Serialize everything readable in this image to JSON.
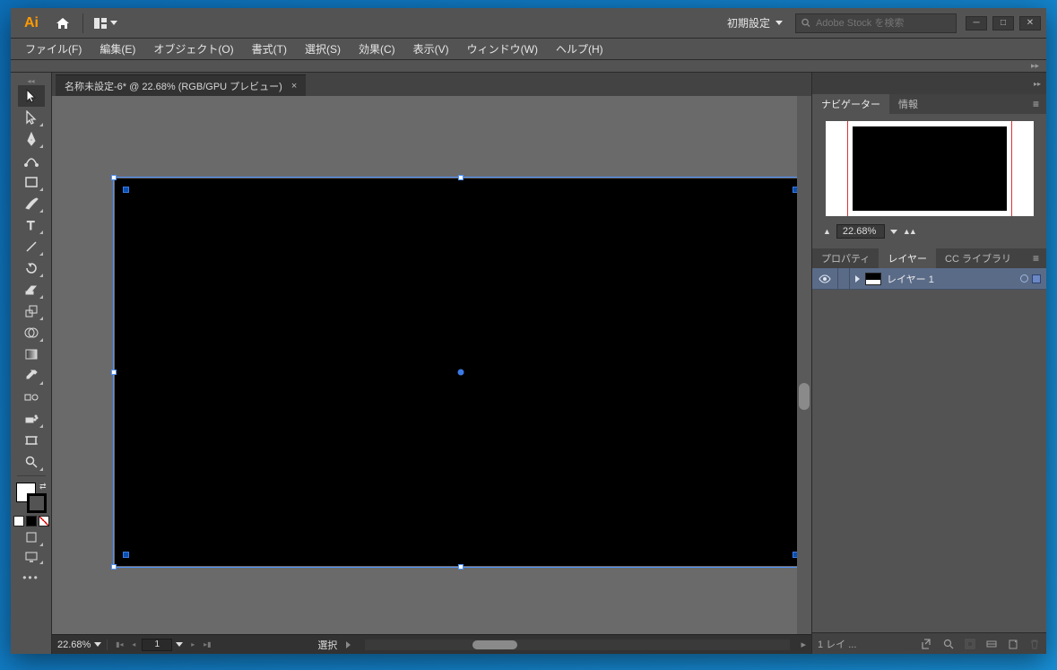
{
  "titlebar": {
    "logo": "Ai",
    "workspace": "初期設定",
    "search_placeholder": "Adobe Stock を検索"
  },
  "menus": [
    "ファイル(F)",
    "編集(E)",
    "オブジェクト(O)",
    "書式(T)",
    "選択(S)",
    "効果(C)",
    "表示(V)",
    "ウィンドウ(W)",
    "ヘルプ(H)"
  ],
  "doc_tab": {
    "label": "名称未設定-6* @ 22.68% (RGB/GPU プレビュー)"
  },
  "status": {
    "zoom": "22.68%",
    "page": "1",
    "mode": "選択"
  },
  "navigator": {
    "tabs": [
      "ナビゲーター",
      "情報"
    ],
    "zoom": "22.68%"
  },
  "panels": {
    "tabs": [
      "プロパティ",
      "レイヤー",
      "CC ライブラリ"
    ]
  },
  "layers": {
    "items": [
      {
        "name": "レイヤー 1"
      }
    ],
    "footer": "1 レイ ..."
  },
  "tools": [
    "selection",
    "direct-selection",
    "pen",
    "curvature",
    "rectangle",
    "paintbrush",
    "type",
    "rotate",
    "eraser",
    "scale",
    "shape-builder",
    "gradient",
    "eyedropper",
    "blend",
    "symbol-sprayer",
    "artboard",
    "zoom"
  ]
}
